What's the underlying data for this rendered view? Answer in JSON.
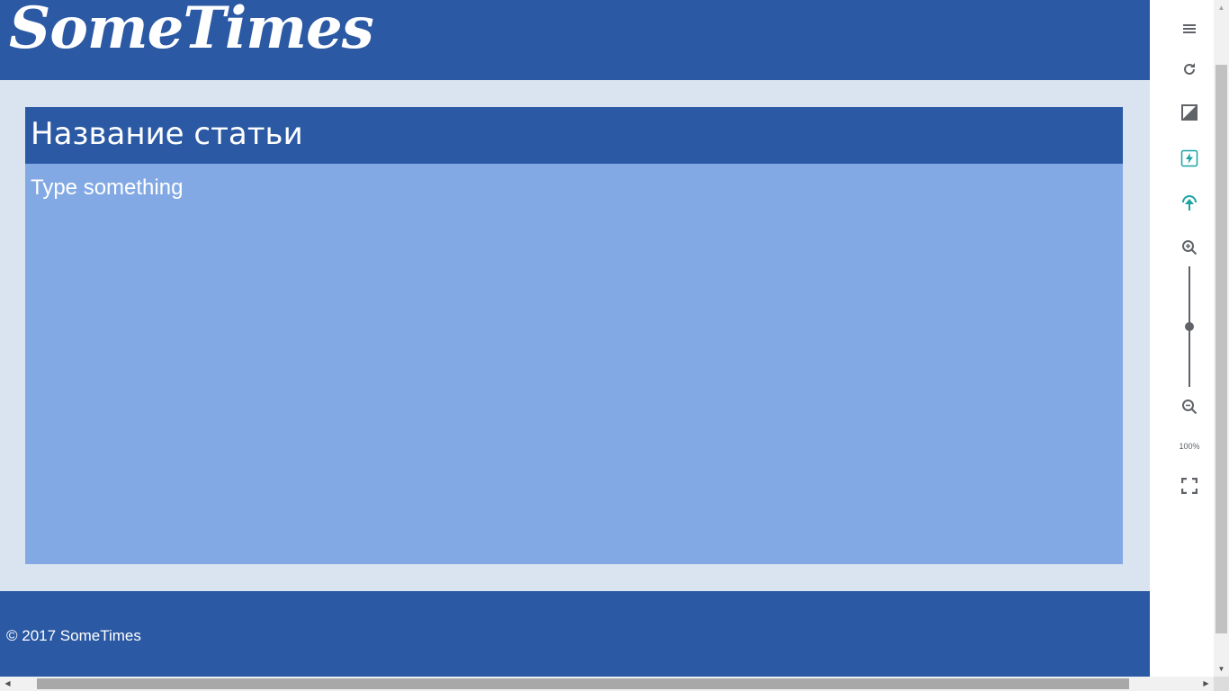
{
  "header": {
    "logo": "SomeTimes"
  },
  "article": {
    "title_value": "Название статьи",
    "body_placeholder": "Type something"
  },
  "footer": {
    "copyright": "© 2017 SomeTimes"
  },
  "toolbar": {
    "tools": [
      {
        "icon": "menu-icon"
      },
      {
        "icon": "refresh-icon"
      },
      {
        "icon": "contrast-icon"
      },
      {
        "icon": "flash-icon",
        "color": "#1aa3a3"
      },
      {
        "icon": "upload-arrow-icon",
        "color": "#1aa3a3"
      },
      {
        "icon": "zoom-in-icon"
      },
      {
        "icon": "zoom-out-icon"
      },
      {
        "icon": "fullscreen-icon"
      }
    ],
    "zoom_slider_fraction": 0.5,
    "zoom_level": "100%"
  },
  "colors": {
    "header_bg": "#2b59a4",
    "page_bg": "#d9e4f0",
    "article_bg": "#83a9e4",
    "icon_gray": "#5f6368",
    "accent_teal": "#1aa3a3"
  }
}
